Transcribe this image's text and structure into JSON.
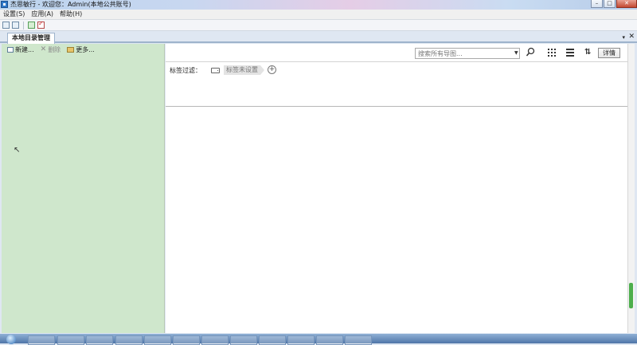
{
  "window": {
    "title": "杰思敏行 - 欢迎您：Admin(本地公共账号)"
  },
  "menu": [
    "设置(S)",
    "应用(A)",
    "帮助(H)"
  ],
  "tab": {
    "label": "本地目录管理",
    "pin": "▾",
    "close": "✕"
  },
  "left_toolbar": {
    "new_label": "新建...",
    "delete_label": "删除",
    "more_label": "更多..."
  },
  "search": {
    "placeholder": "搜索所有导图..."
  },
  "right_toolbar": {
    "detail_label": "详情"
  },
  "filter": {
    "label": "标签过滤：",
    "tag_placeholder": "标签未设置",
    "add_symbol": "+"
  },
  "colors": {
    "left_panel": "#cfe7cc",
    "scroll_thumb": "#4cae4c"
  },
  "icons": [
    "app-icon",
    "search-icon",
    "grid-view-icon",
    "list-view-icon",
    "sort-icon",
    "tag-icon",
    "add-tag-icon",
    "cursor-icon"
  ]
}
